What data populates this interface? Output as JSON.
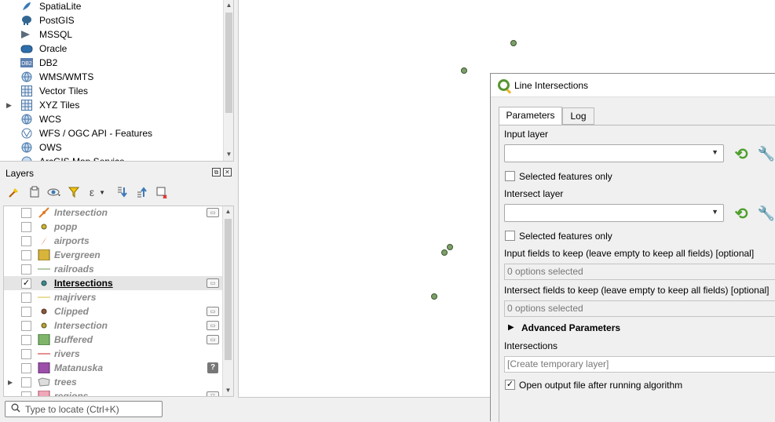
{
  "browser": {
    "items": [
      {
        "label": "SpatiaLite",
        "icon": "feather-icon",
        "expandable": false
      },
      {
        "label": "PostGIS",
        "icon": "elephant-icon",
        "expandable": false
      },
      {
        "label": "MSSQL",
        "icon": "mssql-icon",
        "expandable": false
      },
      {
        "label": "Oracle",
        "icon": "oracle-icon",
        "expandable": false
      },
      {
        "label": "DB2",
        "icon": "db2-icon",
        "expandable": false
      },
      {
        "label": "WMS/WMTS",
        "icon": "globe-icon",
        "expandable": false
      },
      {
        "label": "Vector Tiles",
        "icon": "grid-icon",
        "expandable": false
      },
      {
        "label": "XYZ Tiles",
        "icon": "grid-icon",
        "expandable": true
      },
      {
        "label": "WCS",
        "icon": "globe-icon",
        "expandable": false
      },
      {
        "label": "WFS / OGC API - Features",
        "icon": "wfs-icon",
        "expandable": false
      },
      {
        "label": "OWS",
        "icon": "globe-icon",
        "expandable": false
      },
      {
        "label": "ArcGIS Map Service",
        "icon": "arcgis-icon",
        "expandable": false
      }
    ]
  },
  "layers_panel": {
    "title": "Layers",
    "toolbar": [
      "style-manager-icon",
      "add-group-icon",
      "visibility-icon",
      "filter-icon",
      "expression-filter-icon",
      "expand-all-icon",
      "collapse-all-icon",
      "remove-layer-icon"
    ],
    "layers": [
      {
        "name": "Intersection",
        "symbol": "line-marker-orange",
        "checked": false,
        "active": false,
        "indicator": "temporary",
        "expandable": false
      },
      {
        "name": "popp",
        "symbol": "point-yellow",
        "checked": false,
        "active": false,
        "indicator": "",
        "expandable": false
      },
      {
        "name": "airports",
        "symbol": "airport-orange",
        "checked": false,
        "active": false,
        "indicator": "",
        "expandable": false
      },
      {
        "name": "Evergreen",
        "symbol": "fill-yellow",
        "checked": false,
        "active": false,
        "indicator": "",
        "expandable": false
      },
      {
        "name": "railroads",
        "symbol": "line-green",
        "checked": false,
        "active": false,
        "indicator": "",
        "expandable": false
      },
      {
        "name": "Intersections",
        "symbol": "point-teal",
        "checked": true,
        "active": true,
        "indicator": "temporary",
        "expandable": false
      },
      {
        "name": "majrivers",
        "symbol": "line-yellow",
        "checked": false,
        "active": false,
        "indicator": "",
        "expandable": false
      },
      {
        "name": "Clipped",
        "symbol": "point-brown",
        "checked": false,
        "active": false,
        "indicator": "temporary",
        "expandable": false
      },
      {
        "name": "Intersection",
        "symbol": "point-olive",
        "checked": false,
        "active": false,
        "indicator": "temporary",
        "expandable": false
      },
      {
        "name": "Buffered",
        "symbol": "fill-green",
        "checked": false,
        "active": false,
        "indicator": "temporary",
        "expandable": false
      },
      {
        "name": "rivers",
        "symbol": "line-red",
        "checked": false,
        "active": false,
        "indicator": "",
        "expandable": false
      },
      {
        "name": "Matanuska",
        "symbol": "fill-purple",
        "checked": false,
        "active": false,
        "indicator": "help",
        "expandable": false
      },
      {
        "name": "trees",
        "symbol": "group-shape",
        "checked": false,
        "active": false,
        "indicator": "",
        "expandable": true
      },
      {
        "name": "regions",
        "symbol": "fill-pink",
        "checked": false,
        "active": false,
        "indicator": "filter",
        "expandable": false
      }
    ]
  },
  "locator": {
    "placeholder": "Type to locate (Ctrl+K)"
  },
  "map": {
    "point_color": "#7da068"
  },
  "dialog": {
    "title": "Line Intersections",
    "tabs": [
      "Parameters",
      "Log"
    ],
    "input_layer_label": "Input layer",
    "input_layer_value": "",
    "selected_only_label_1": "Selected features only",
    "intersect_layer_label": "Intersect layer",
    "intersect_layer_value": "",
    "selected_only_label_2": "Selected features only",
    "input_fields_label": "Input fields to keep (leave empty to keep all fields) [optional]",
    "input_fields_value": "0 options selected",
    "intersect_fields_label": "Intersect fields to keep (leave empty to keep all fields) [optional]",
    "intersect_fields_value": "0 options selected",
    "advanced_label": "Advanced Parameters",
    "output_label": "Intersections",
    "output_value": "[Create temporary layer]",
    "open_output_label": "Open output file after running algorithm",
    "open_output_checked": true
  }
}
